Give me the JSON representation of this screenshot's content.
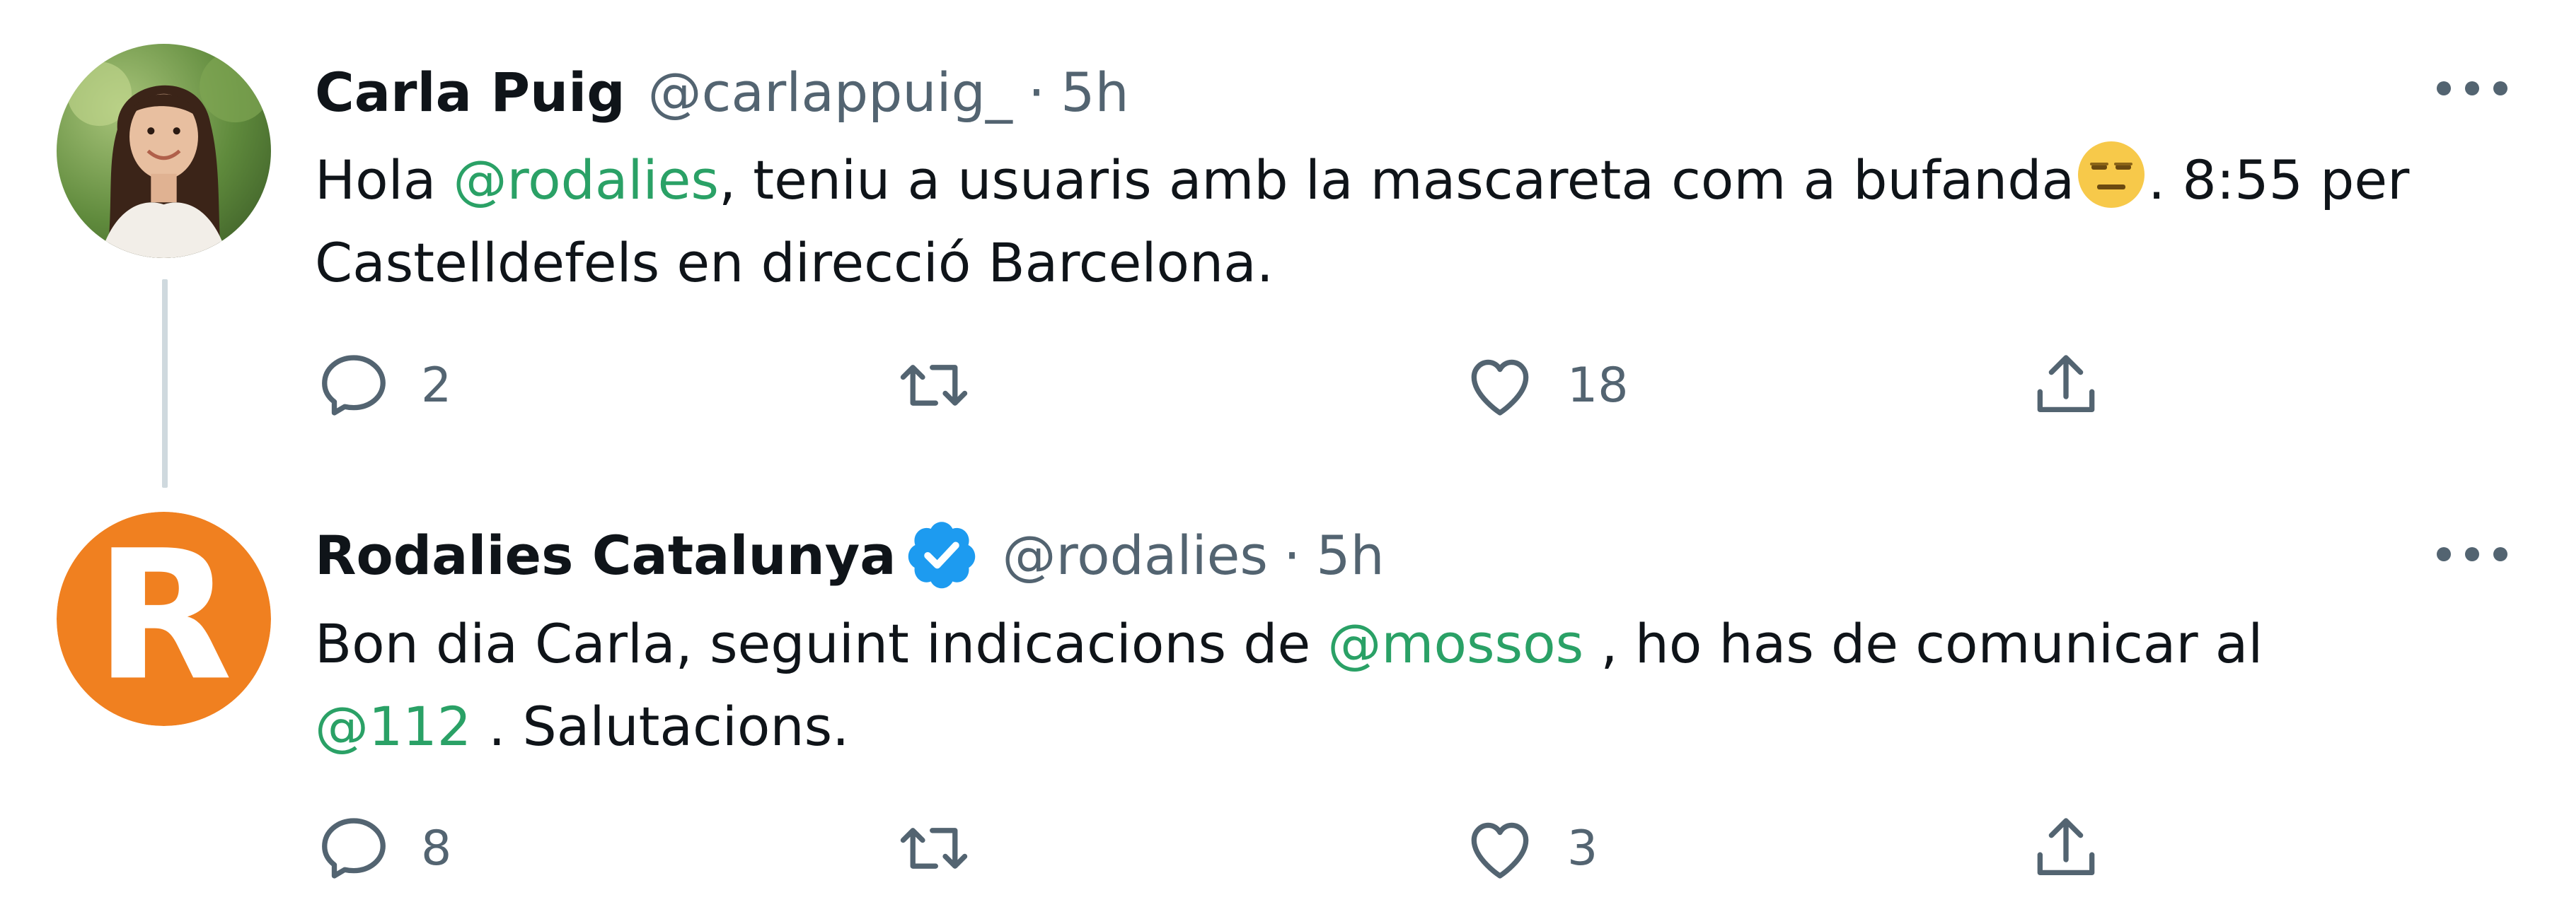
{
  "tweets": [
    {
      "author": {
        "name": "Carla Puig",
        "handle": "@carlappuig_",
        "verified": false,
        "avatar": "woman-portrait-photo"
      },
      "separator": "·",
      "time": "5h",
      "text": {
        "part1": "Hola ",
        "mention1": "@rodalies",
        "part2": ", teniu a usuaris amb la mascareta com a bufanda",
        "emoji": "expressionless-face-emoji",
        "part3": ". 8:55 per",
        "line2": "Castelldefels en direcció Barcelona."
      },
      "actions": {
        "replies": "2",
        "retweets": "",
        "likes": "18"
      }
    },
    {
      "author": {
        "name": "Rodalies Catalunya",
        "handle": "@rodalies",
        "verified": true,
        "avatar_letter": "R",
        "avatar_color": "#f08020"
      },
      "separator": "·",
      "time": "5h",
      "text": {
        "part1": "Bon dia Carla, seguint indicacions de ",
        "mention1": "@mossos",
        "part2": " , ho has de comunicar al",
        "mention2": "@112",
        "part3": " . Salutacions."
      },
      "actions": {
        "replies": "8",
        "retweets": "",
        "likes": "3"
      }
    }
  ],
  "colors": {
    "mention": "#2aa166",
    "secondary_text": "#536471",
    "verified_badge": "#1d9bf0",
    "thread_line": "#cfd9de"
  },
  "icons": [
    "reply-icon",
    "retweet-icon",
    "like-icon",
    "share-icon",
    "more-options-icon",
    "verified-badge-icon"
  ]
}
